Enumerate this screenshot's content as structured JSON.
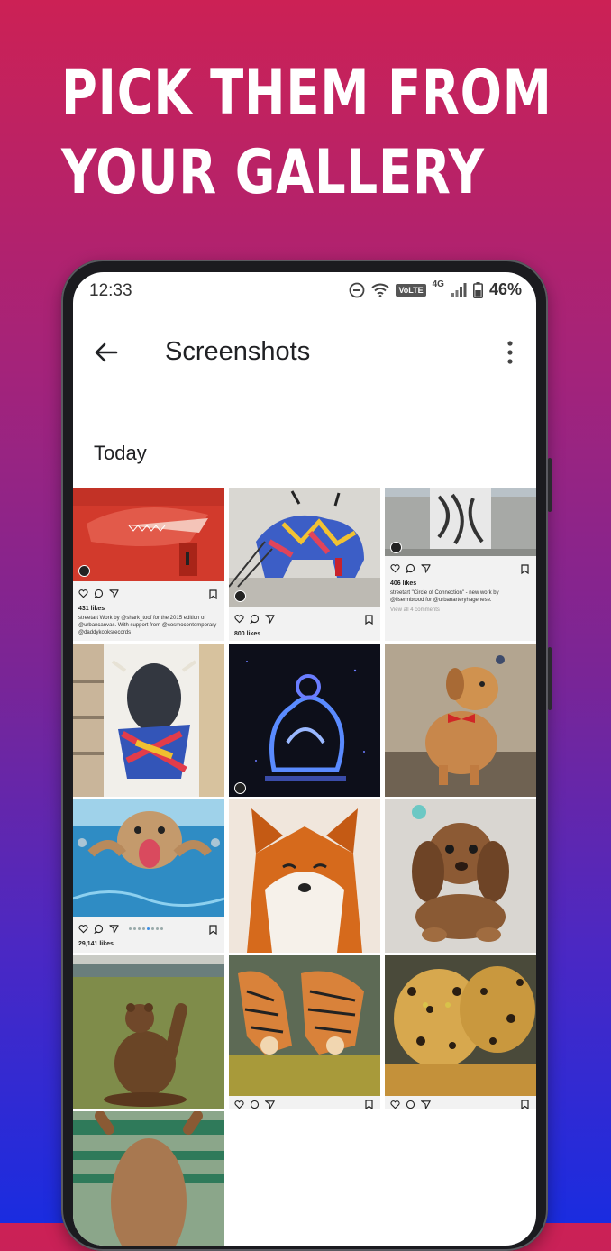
{
  "headline": {
    "line1": "PICK THEM FROM",
    "line2": "YOUR GALLERY"
  },
  "status_bar": {
    "time": "12:33",
    "volte": "VoLTE",
    "network": "4G",
    "battery": "46%"
  },
  "app_bar": {
    "title": "Screenshots"
  },
  "section_label": "Today",
  "tiles": [
    {
      "likes": "431 likes",
      "caption": "streetart Work by @shark_toof for the 2015 edition of @urbancanvas. With support from @cosmocontemporary @daddykooksrecords"
    },
    {
      "likes": "800 likes"
    },
    {
      "likes": "406 likes",
      "caption": "streetart \"Circle of Connection\" - new work by @lisermbrood for @urbanarteryhagenese.",
      "comments": "View all 4 comments"
    },
    {
      "likes": "29,141 likes"
    }
  ],
  "colors": {
    "gradient_top": "#cc2155",
    "gradient_bottom": "#1a2ce0",
    "text_primary": "#202124"
  }
}
